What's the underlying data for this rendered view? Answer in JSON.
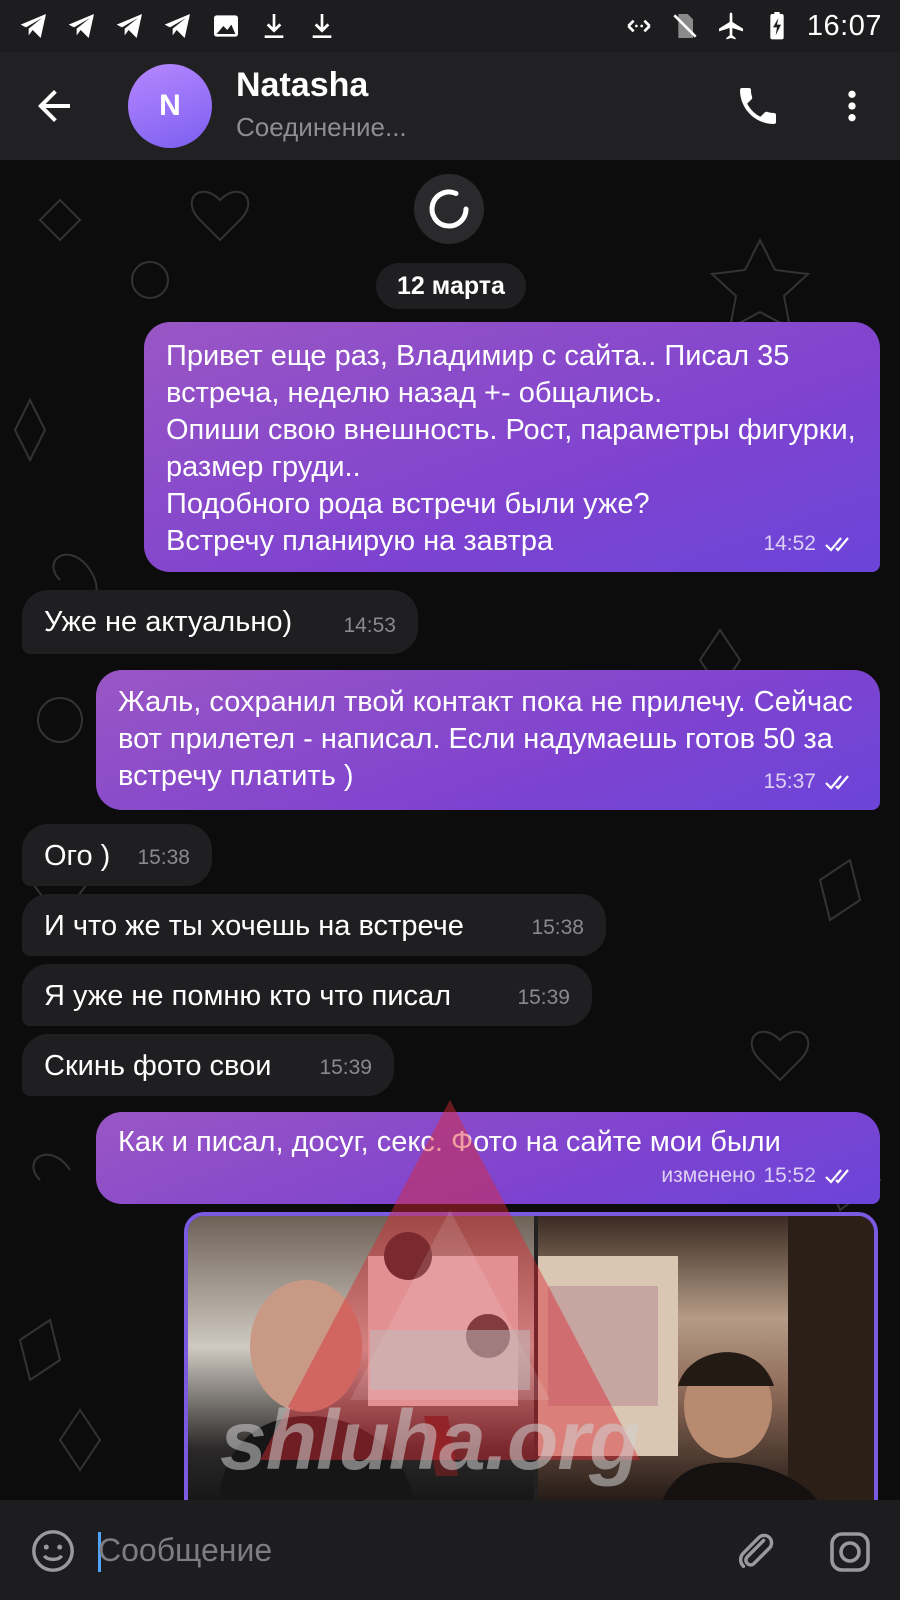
{
  "status_bar": {
    "time": "16:07",
    "left_icons": [
      "telegram-icon",
      "telegram-icon",
      "telegram-icon",
      "telegram-icon",
      "gallery-icon",
      "download-icon",
      "download-icon"
    ],
    "right_icons": [
      "nfc-icon",
      "no-sim-icon",
      "airplane-icon",
      "battery-charging-icon"
    ]
  },
  "header": {
    "avatar_letter": "N",
    "name": "Natasha",
    "status": "Соединение..."
  },
  "chat": {
    "date": "12 марта",
    "messages": [
      {
        "dir": "out",
        "text": "Привет еще раз, Владимир с сайта.. Писал 35 встреча, неделю назад +- общались.\nОпиши свою внешность. Рост, параметры фигурки, размер груди..\nПодобного рода встречи были уже?\nВстречу планирую на завтра",
        "time": "14:52",
        "read": true
      },
      {
        "dir": "in",
        "text": "Уже не актуально)",
        "time": "14:53"
      },
      {
        "dir": "out",
        "text": "Жаль, сохранил твой контакт пока не прилечу. Сейчас вот прилетел - написал. Если надумаешь готов 50 за встречу платить )",
        "time": "15:37",
        "read": true
      },
      {
        "dir": "in",
        "text": "Ого )",
        "time": "15:38"
      },
      {
        "dir": "in",
        "text": "И что же ты хочешь на встрече",
        "time": "15:38"
      },
      {
        "dir": "in",
        "text": "Я уже не помню кто что писал",
        "time": "15:39"
      },
      {
        "dir": "in",
        "text": "Скинь фото свои",
        "time": "15:39"
      },
      {
        "dir": "out",
        "text": "Как и писал, досуг, секс. Фото на сайте мои были",
        "edited_label": "изменено",
        "time": "15:52",
        "read": true
      }
    ]
  },
  "watermark": {
    "text": "shluha.org"
  },
  "input": {
    "placeholder": "Сообщение"
  },
  "colors": {
    "outgoing_bubble": "#8a4cd0",
    "incoming_bubble": "#1f1f21",
    "header": "#212123",
    "avatar": "#9a6ff8",
    "caret": "#4fa3ff"
  }
}
